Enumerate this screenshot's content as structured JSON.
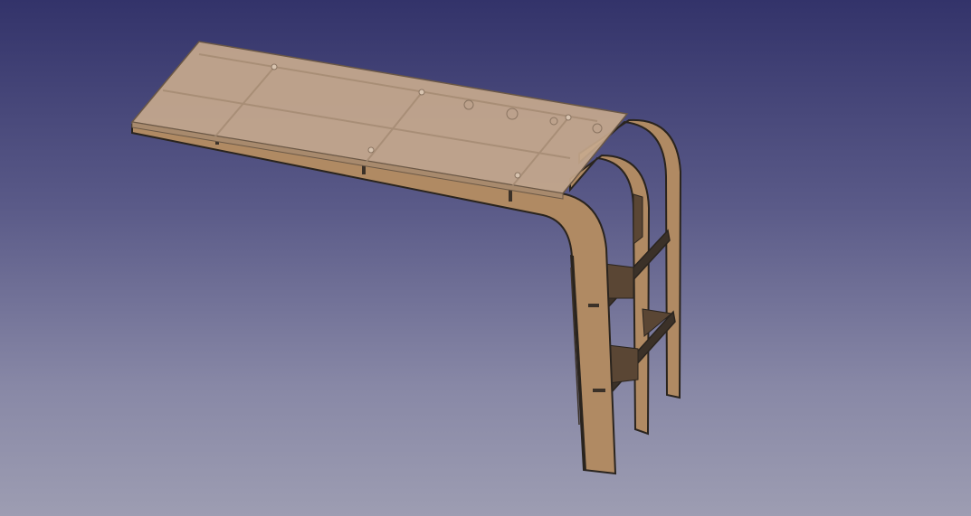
{
  "viewport": {
    "background_top": "#33336a",
    "background_bottom": "#9d9db2"
  },
  "model": {
    "panel_color": "#b08a63",
    "panel_edge_color": "#2a241e",
    "slot_color": "#3b3128",
    "top_color": "#c7a98d"
  }
}
